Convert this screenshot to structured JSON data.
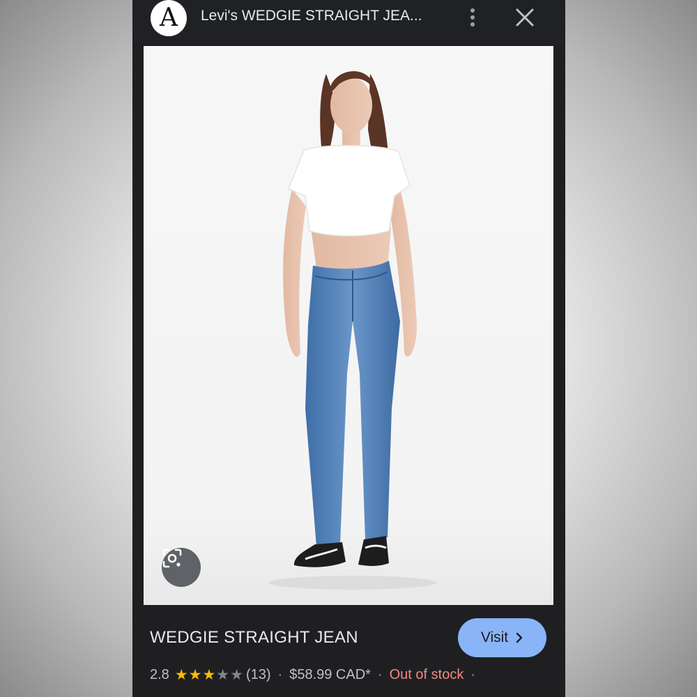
{
  "header": {
    "logo_letter": "A",
    "title": "Levi's WEDGIE STRAIGHT JEA..."
  },
  "product": {
    "name": "WEDGIE STRAIGHT JEAN",
    "visit_label": "Visit",
    "rating": "2.8",
    "rating_value": 2.8,
    "rating_max": 5,
    "review_count": "(13)",
    "price": "$58.99 CAD*",
    "stock_status": "Out of stock",
    "separator": "·"
  },
  "icons": {
    "logo": "site-logo",
    "more": "more-vert-icon",
    "close": "close-icon",
    "lens": "lens-search-icon",
    "chevron": "chevron-right-icon",
    "star": "star-icon"
  },
  "colors": {
    "panel_bg": "#1f1f22",
    "visit_button": "#8ab4f8",
    "star_filled": "#fbbc04",
    "star_empty": "#80868b",
    "out_of_stock": "#f28b82"
  }
}
